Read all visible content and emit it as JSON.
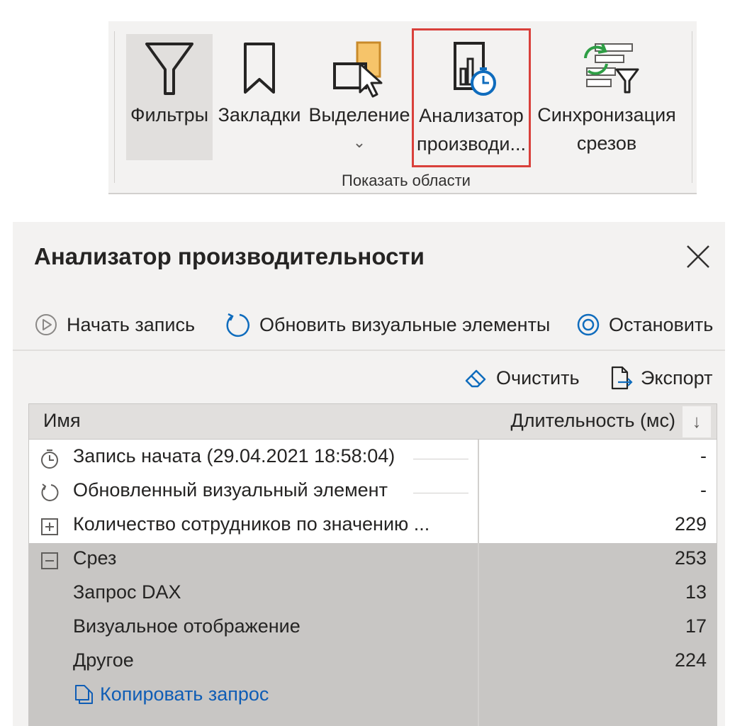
{
  "ribbon": {
    "buttons": {
      "filters": "Фильтры",
      "bookmarks": "Закладки",
      "selection": "Выделение",
      "selection_chevron": "⌄",
      "perf_line1": "Анализатор",
      "perf_line2": "производи...",
      "sync_line1": "Синхронизация",
      "sync_line2": "срезов"
    },
    "group_label": "Показать области",
    "colors": {
      "highlight_border": "#d9403b",
      "accent_blue": "#0f6cbd",
      "sync_green": "#2e9e45"
    }
  },
  "panel": {
    "title": "Анализатор производительности",
    "actions": {
      "start": "Начать запись",
      "refresh": "Обновить визуальные элементы",
      "stop": "Остановить"
    },
    "tools": {
      "clear": "Очистить",
      "export": "Экспорт"
    },
    "table": {
      "col_name": "Имя",
      "col_duration": "Длительность (мс)",
      "sort_icon": "↓",
      "rows": [
        {
          "icon": "stopwatch-icon",
          "name": "Запись начата (29.04.2021 18:58:04)",
          "value": "-"
        },
        {
          "icon": "refresh-icon",
          "name": "Обновленный визуальный элемент",
          "value": "-"
        },
        {
          "icon": "expand-icon",
          "name": "Количество сотрудников по значению ...",
          "value": "229"
        },
        {
          "icon": "collapse-icon",
          "name": "Срез",
          "value": "253"
        },
        {
          "icon": "",
          "name": "Запрос DAX",
          "value": "13"
        },
        {
          "icon": "",
          "name": "Визуальное отображение",
          "value": "17"
        },
        {
          "icon": "",
          "name": "Другое",
          "value": "224"
        }
      ],
      "copy_query": "Копировать запрос"
    }
  }
}
